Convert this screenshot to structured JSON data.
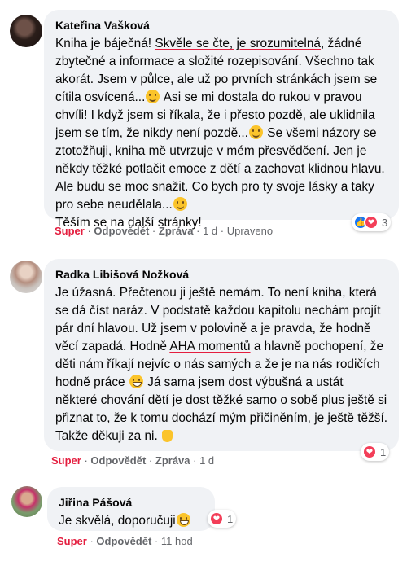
{
  "comments": [
    {
      "author": "Kateřina Vašková",
      "text_parts": {
        "p1": "Kniha je báječná! ",
        "u1": "Skvěle se čte, je srozumitelná",
        "p2": ", žádné zbytečné a informace a složité rozepisování. Všechno tak akorát. Jsem v půlce, ale už po prvních stránkách jsem se cítila osvícená...",
        "p3": " Asi se mi dostala do rukou v pravou chvíli! I když jsem si říkala, že i přesto pozdě, ale uklidnila jsem se tím, že nikdy není pozdě...",
        "p4": " Se všemi názory se ztotožňuji, kniha mě utvrzuje v mém přesvědčení. Jen je někdy těžké potlačit emoce z dětí a zachovat klidnou hlavu. Ale budu se moc snažit. Co bych pro ty svoje lásky a taky pro sebe neudělala...",
        "p5": "Těším se na další stránky!"
      },
      "actions": {
        "super": "Super",
        "reply": "Odpovědět",
        "message": "Zpráva",
        "time": "1 d",
        "edited": "Upraveno"
      },
      "reactions": {
        "count": "3",
        "icons": [
          "like-icon",
          "heart-icon"
        ]
      }
    },
    {
      "author": "Radka Libišová Nožková",
      "text_parts": {
        "p1": "Je úžasná. Přečtenou ji ještě nemám. To není kniha, která se dá číst naráz. V podstatě každou kapitolu nechám projít pár dní hlavou. Už jsem v polovině a je pravda, že hodně věcí zapadá. Hodně ",
        "u1": "AHA momentů",
        "p2": " a hlavně pochopení, že děti nám říkají nejvíc o nás samých a že je na nás rodičích hodně práce",
        "p3": " Já sama jsem dost výbušná a ustát některé chování dětí je dost těžké samo o sobě plus ještě si přiznat to, že k tomu dochází mým přičiněním, je ještě těžší. Takže děkuji za ni."
      },
      "actions": {
        "super": "Super",
        "reply": "Odpovědět",
        "message": "Zpráva",
        "time": "1 d"
      },
      "reactions": {
        "count": "1",
        "icons": [
          "heart-icon"
        ]
      }
    },
    {
      "author": "Jiřina Pášová",
      "text": "Je skvělá, doporučuji",
      "actions": {
        "super": "Super",
        "reply": "Odpovědět",
        "time": "11 hod"
      },
      "reactions": {
        "count": "1",
        "icons": [
          "heart-icon"
        ]
      }
    }
  ],
  "colors": {
    "bubble": "#f0f2f5",
    "accent_red": "#e41e3f",
    "like_blue": "#1877f2",
    "heart": "#f33e58",
    "meta_gray": "#65676b"
  }
}
